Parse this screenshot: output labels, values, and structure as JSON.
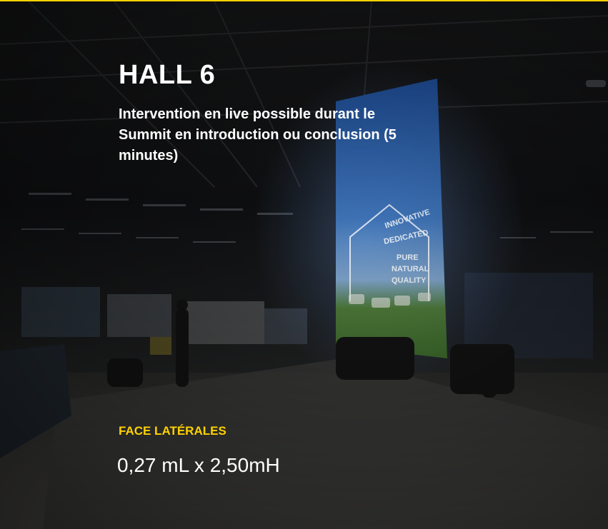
{
  "colors": {
    "accent": "#ffd200",
    "text": "#ffffff"
  },
  "photo": {
    "subject": "dimmed exhibition hall with a large backlit banner",
    "banner_text": [
      "INNOVATIVE",
      "DEDICATED",
      "PURE",
      "NATURAL",
      "QUALITY"
    ]
  },
  "overlay": {
    "title": "HALL 6",
    "description": "Intervention en live possible durant le Summit en introduction ou conclusion (5 minutes)",
    "spec_label": "FACE LATÉRALES",
    "spec_value": "0,27 mL x 2,50mH"
  }
}
